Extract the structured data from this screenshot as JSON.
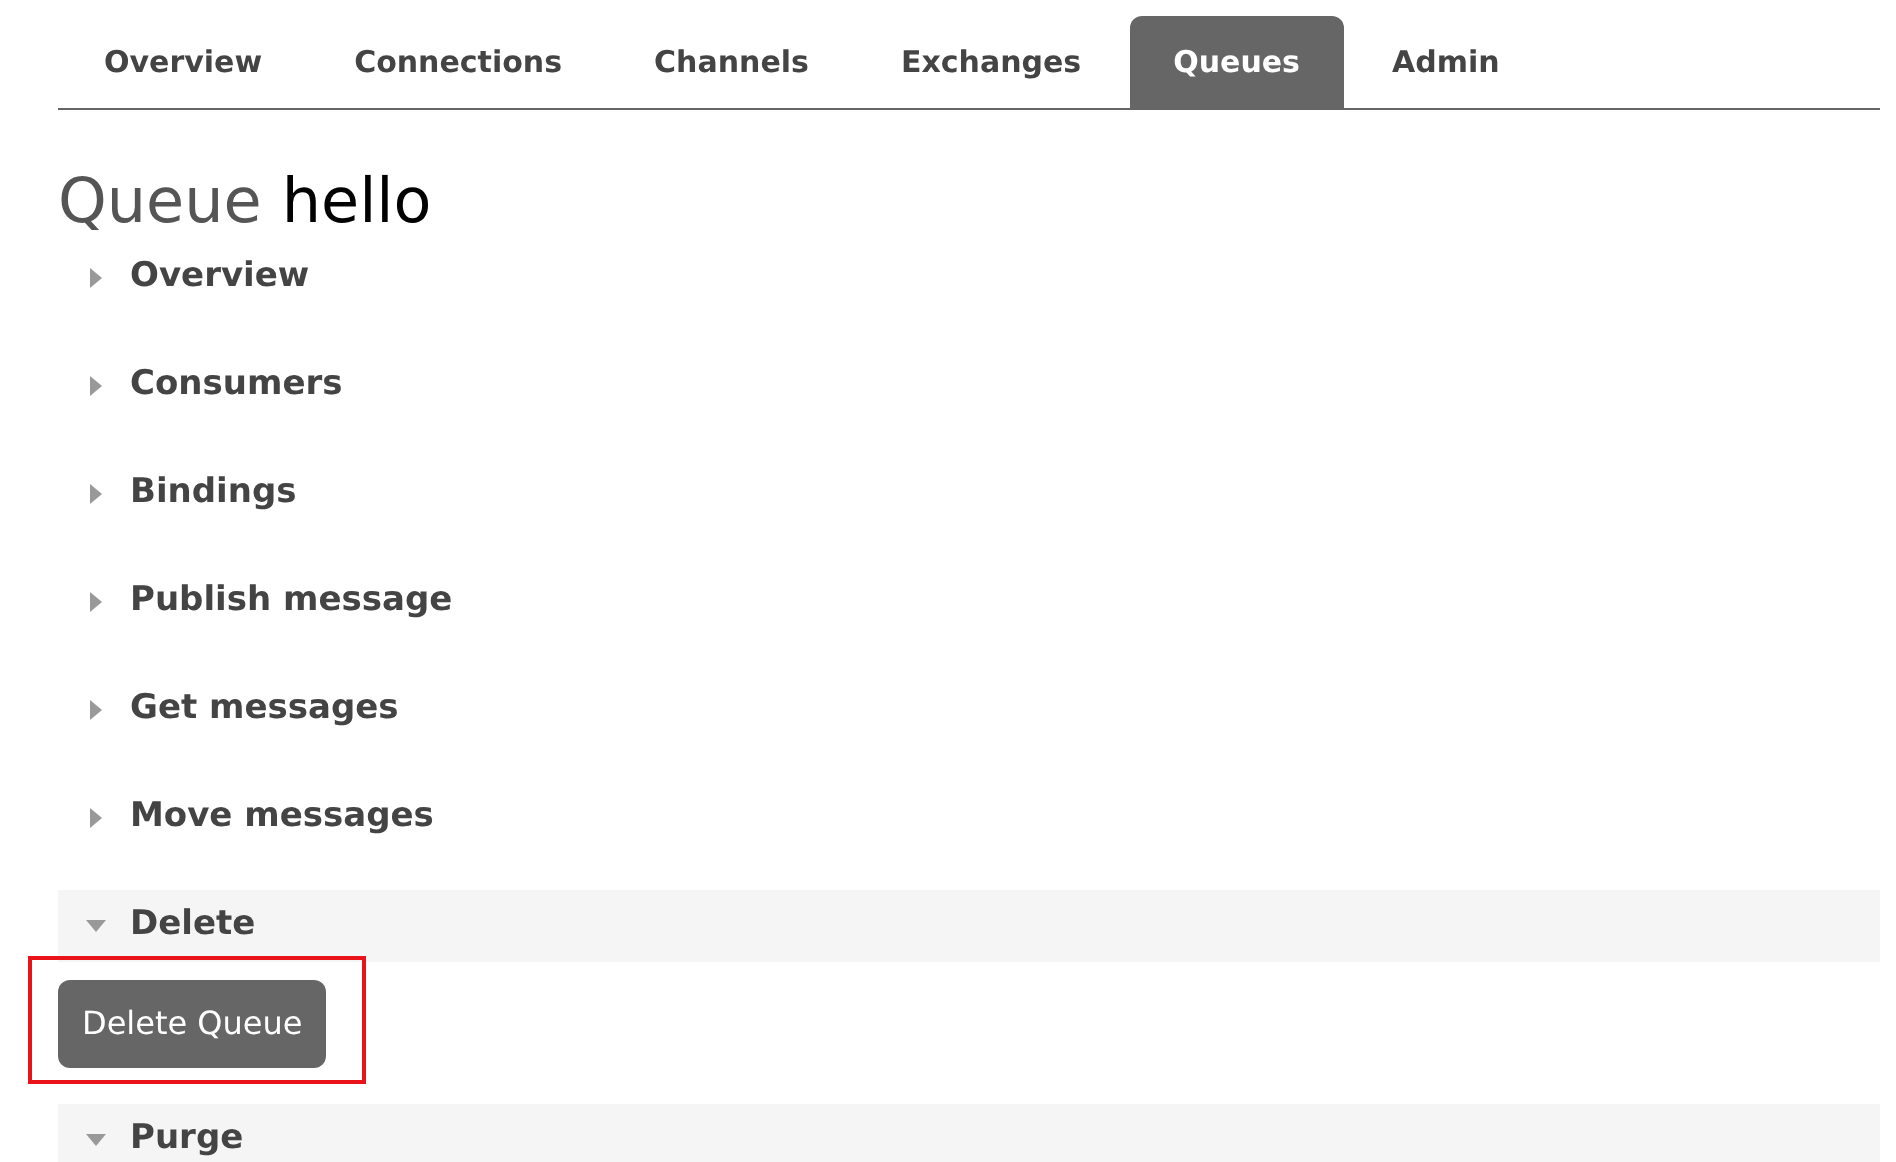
{
  "tabs": [
    {
      "label": "Overview",
      "selected": false
    },
    {
      "label": "Connections",
      "selected": false
    },
    {
      "label": "Channels",
      "selected": false
    },
    {
      "label": "Exchanges",
      "selected": false
    },
    {
      "label": "Queues",
      "selected": true
    },
    {
      "label": "Admin",
      "selected": false
    }
  ],
  "page_title": {
    "label": "Queue",
    "name": "hello"
  },
  "sections": [
    {
      "title": "Overview",
      "expanded": false
    },
    {
      "title": "Consumers",
      "expanded": false
    },
    {
      "title": "Bindings",
      "expanded": false
    },
    {
      "title": "Publish message",
      "expanded": false
    },
    {
      "title": "Get messages",
      "expanded": false
    },
    {
      "title": "Move messages",
      "expanded": false
    },
    {
      "title": "Delete",
      "expanded": true,
      "button": {
        "label": "Delete Queue",
        "highlighted": true
      }
    },
    {
      "title": "Purge",
      "expanded": true
    }
  ]
}
